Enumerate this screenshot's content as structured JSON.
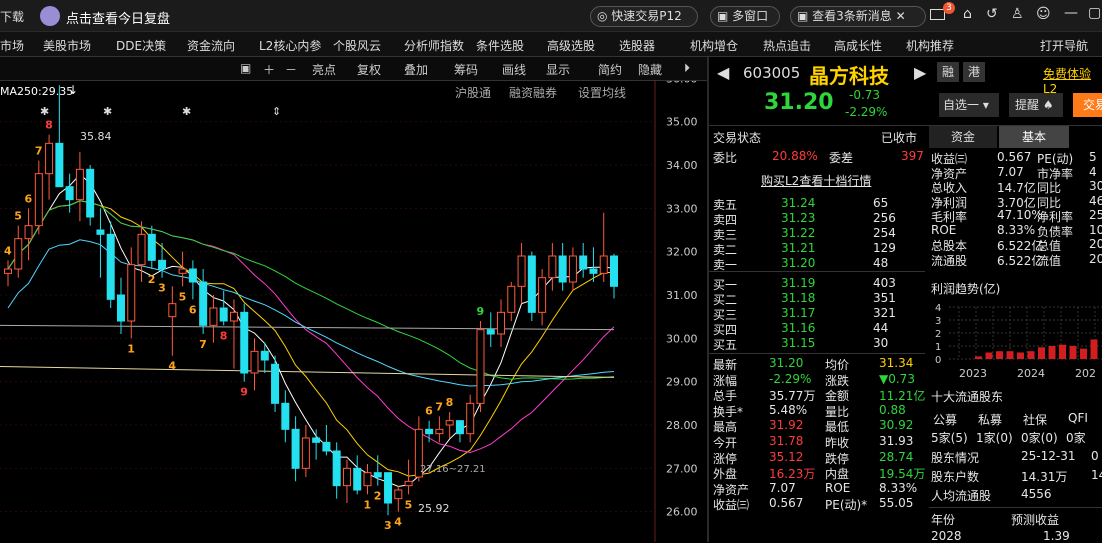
{
  "topbar": {
    "download": "下载",
    "review": "点击查看今日复盘",
    "quick_trade": "快速交易P12",
    "multi_window": "多窗口",
    "news": "查看3条新消息",
    "mail_badge": "3"
  },
  "menu": [
    "市场",
    "美股市场",
    "DDE决策",
    "资金流向",
    "L2核心内参",
    "个股风云",
    "分析师指数",
    "条件选股",
    "高级选股",
    "选股器",
    "机构增仓",
    "热点追击",
    "高成长性",
    "机构推荐",
    "打开导航"
  ],
  "toolbar": [
    "亮点",
    "复权",
    "叠加",
    "筹码",
    "画线",
    "显示",
    "简约",
    "隐藏"
  ],
  "chart_header": {
    "ma_label": "MA250:29.35",
    "sublinks": [
      "沪股通",
      "融资融券",
      "设置均线"
    ]
  },
  "chart_data": {
    "type": "candlestick",
    "y_ticks": [
      "36.00",
      "35.00",
      "34.00",
      "33.00",
      "32.00",
      "31.00",
      "30.00",
      "29.00",
      "28.00",
      "27.00",
      "26.00"
    ],
    "ylim": [
      25.6,
      36.4
    ],
    "high_label": "35.84",
    "low_label": "25.92",
    "mid_label": "27.16~27.21",
    "candles": [
      [
        31.5,
        31.8,
        31.2,
        31.6
      ],
      [
        31.6,
        32.6,
        31.4,
        32.3
      ],
      [
        32.3,
        33.0,
        31.8,
        32.6
      ],
      [
        32.6,
        34.1,
        32.4,
        33.8
      ],
      [
        33.8,
        34.7,
        33.2,
        34.5
      ],
      [
        34.5,
        35.84,
        33.6,
        33.5
      ],
      [
        33.5,
        33.8,
        32.9,
        33.2
      ],
      [
        33.2,
        34.3,
        32.7,
        33.9
      ],
      [
        33.9,
        34.0,
        32.6,
        32.8
      ],
      [
        32.5,
        33.0,
        31.4,
        32.4
      ],
      [
        32.4,
        32.7,
        30.7,
        30.9
      ],
      [
        31.0,
        31.4,
        30.1,
        30.4
      ],
      [
        30.4,
        32.1,
        30.0,
        31.7
      ],
      [
        31.7,
        32.7,
        31.3,
        32.4
      ],
      [
        32.4,
        32.6,
        31.6,
        31.8
      ],
      [
        31.8,
        32.2,
        31.4,
        31.6
      ],
      [
        30.5,
        31.2,
        29.6,
        30.8
      ],
      [
        31.5,
        32.0,
        31.2,
        31.6
      ],
      [
        31.6,
        31.8,
        30.9,
        31.3
      ],
      [
        31.3,
        31.6,
        30.1,
        30.3
      ],
      [
        30.3,
        31.0,
        29.9,
        30.7
      ],
      [
        30.7,
        31.1,
        30.3,
        30.4
      ],
      [
        30.4,
        30.9,
        29.3,
        30.6
      ],
      [
        30.6,
        30.8,
        29.0,
        29.2
      ],
      [
        29.2,
        30.0,
        28.8,
        29.7
      ],
      [
        29.7,
        29.9,
        29.2,
        29.5
      ],
      [
        29.4,
        29.6,
        28.3,
        28.5
      ],
      [
        28.5,
        28.8,
        27.6,
        27.9
      ],
      [
        27.9,
        28.2,
        26.7,
        27.0
      ],
      [
        27.0,
        28.0,
        26.8,
        27.7
      ],
      [
        27.7,
        27.9,
        27.2,
        27.6
      ],
      [
        27.6,
        28.0,
        27.3,
        27.4
      ],
      [
        27.4,
        27.6,
        26.3,
        26.6
      ],
      [
        26.6,
        27.2,
        26.2,
        27.0
      ],
      [
        27.0,
        27.3,
        26.4,
        26.5
      ],
      [
        26.6,
        27.1,
        26.4,
        26.9
      ],
      [
        26.9,
        27.3,
        26.6,
        26.8
      ],
      [
        26.9,
        26.9,
        25.92,
        26.2
      ],
      [
        26.3,
        26.6,
        26.0,
        26.5
      ],
      [
        26.6,
        27.2,
        26.4,
        26.7
      ],
      [
        26.8,
        28.2,
        26.7,
        27.9
      ],
      [
        27.9,
        28.1,
        27.6,
        27.8
      ],
      [
        27.8,
        28.2,
        27.6,
        27.9
      ],
      [
        28.0,
        28.3,
        27.7,
        28.1
      ],
      [
        28.1,
        28.1,
        27.6,
        27.8
      ],
      [
        27.8,
        28.7,
        27.6,
        28.5
      ],
      [
        28.5,
        30.4,
        28.3,
        30.2
      ],
      [
        30.2,
        30.6,
        29.8,
        30.1
      ],
      [
        30.1,
        30.9,
        29.8,
        30.6
      ],
      [
        30.6,
        31.3,
        30.4,
        31.2
      ],
      [
        31.2,
        32.2,
        30.8,
        31.9
      ],
      [
        31.9,
        32.0,
        30.4,
        30.6
      ],
      [
        30.6,
        31.6,
        30.3,
        31.4
      ],
      [
        31.4,
        32.2,
        31.1,
        31.9
      ],
      [
        31.9,
        32.2,
        31.1,
        31.3
      ],
      [
        31.3,
        32.1,
        31.1,
        31.9
      ],
      [
        31.9,
        32.2,
        31.4,
        31.6
      ],
      [
        31.6,
        32.1,
        31.3,
        31.5
      ],
      [
        31.5,
        32.9,
        31.3,
        31.9
      ],
      [
        31.9,
        31.95,
        30.92,
        31.2
      ]
    ],
    "digit_labels": [
      [
        0,
        "4",
        "y"
      ],
      [
        1,
        "5",
        "y"
      ],
      [
        2,
        "6",
        "y"
      ],
      [
        3,
        "7",
        "y"
      ],
      [
        4,
        "8",
        "r"
      ],
      [
        5,
        "9",
        "g"
      ],
      [
        12,
        "1",
        "y"
      ],
      [
        14,
        "2",
        "y"
      ],
      [
        15,
        "3",
        "y"
      ],
      [
        16,
        "4",
        "y"
      ],
      [
        17,
        "5",
        "y"
      ],
      [
        18,
        "6",
        "y"
      ],
      [
        19,
        "7",
        "y"
      ],
      [
        21,
        "8",
        "r"
      ],
      [
        23,
        "9",
        "r"
      ],
      [
        35,
        "1",
        "y"
      ],
      [
        36,
        "2",
        "y"
      ],
      [
        37,
        "3",
        "y"
      ],
      [
        38,
        "4",
        "y"
      ],
      [
        39,
        "5",
        "y"
      ],
      [
        41,
        "6",
        "y"
      ],
      [
        42,
        "7",
        "y"
      ],
      [
        43,
        "8",
        "y"
      ],
      [
        46,
        "9",
        "g"
      ]
    ]
  },
  "stock": {
    "code": "603005",
    "name": "晶方科技",
    "price": "31.20",
    "change": "-0.73",
    "pct": "-2.29%",
    "tags": [
      "融",
      "港"
    ],
    "trial": "免费体验L2",
    "watch": "自选一",
    "alert": "提醒",
    "trade": "交易",
    "status_label": "交易状态",
    "status": "已收市",
    "ratio_label": "委比",
    "ratio": "20.88%",
    "diff_label": "委差",
    "diff": "397",
    "l2_link": "购买L2查看十档行情",
    "asks": [
      [
        "卖五",
        "31.24",
        "65"
      ],
      [
        "卖四",
        "31.23",
        "256"
      ],
      [
        "卖三",
        "31.22",
        "254"
      ],
      [
        "卖二",
        "31.21",
        "129"
      ],
      [
        "卖一",
        "31.20",
        "48"
      ]
    ],
    "bids": [
      [
        "买一",
        "31.19",
        "403"
      ],
      [
        "买二",
        "31.18",
        "351"
      ],
      [
        "买三",
        "31.17",
        "321"
      ],
      [
        "买四",
        "31.16",
        "44"
      ],
      [
        "买五",
        "31.15",
        "30"
      ]
    ],
    "stats": [
      [
        "最新",
        "31.20",
        "均价",
        "31.34"
      ],
      [
        "涨幅",
        "-2.29%",
        "涨跌",
        "▼0.73"
      ],
      [
        "总手",
        "35.77万",
        "金额",
        "11.21亿"
      ],
      [
        "换手*",
        "5.48%",
        "量比",
        "0.88"
      ],
      [
        "最高",
        "31.92",
        "最低",
        "30.92"
      ],
      [
        "今开",
        "31.78",
        "昨收",
        "31.93"
      ],
      [
        "涨停",
        "35.12",
        "跌停",
        "28.74"
      ],
      [
        "外盘",
        "16.23万",
        "内盘",
        "19.54万"
      ],
      [
        "净资产",
        "7.07",
        "ROE",
        "8.33%"
      ],
      [
        "收益㈢",
        "0.567",
        "PE(动)*",
        "55.05"
      ]
    ],
    "tabs": [
      "资金",
      "基本"
    ],
    "fund": [
      [
        "收益㈢",
        "0.567",
        "PE(动)",
        "5"
      ],
      [
        "净资产",
        "7.07",
        "市净率",
        "4"
      ],
      [
        "总收入",
        "14.7亿",
        "同比",
        "30"
      ],
      [
        "净利润",
        "3.70亿",
        "同比",
        "46"
      ],
      [
        "毛利率",
        "47.10%",
        "净利率",
        "25"
      ],
      [
        "ROE",
        "8.33%",
        "负债率",
        "10"
      ],
      [
        "总股本",
        "6.522亿",
        "总值",
        "20"
      ],
      [
        "流通股",
        "6.522亿",
        "流值",
        "20"
      ]
    ],
    "profit_title": "利润趋势(亿)",
    "profit_years": [
      "2023",
      "2024",
      "202"
    ],
    "profit_y": [
      "4",
      "3",
      "2",
      "1",
      "0"
    ],
    "profit_values": [
      0.2,
      0.5,
      0.6,
      0.6,
      0.5,
      0.6,
      0.9,
      1.0,
      1.1,
      1.0,
      0.8,
      1.5
    ],
    "holders_title": "十大流通股东",
    "holder_heads": [
      "公募",
      "私募",
      "社保",
      "QFI"
    ],
    "holder_vals": [
      "5家(5)",
      "1家(0)",
      "0家(0)",
      "0家"
    ],
    "holder_rows": [
      [
        "股东情况",
        "25-12-31",
        "0"
      ],
      [
        "股东户数",
        "14.31万",
        "14"
      ],
      [
        "人均流通股",
        "4556",
        ""
      ]
    ],
    "year_heads": [
      "年份",
      "预测收益"
    ],
    "year_row": [
      "2028",
      "1.39"
    ]
  }
}
